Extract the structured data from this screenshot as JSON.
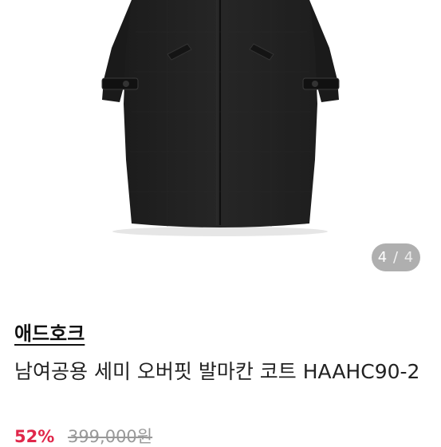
{
  "gallery": {
    "current_page": "4",
    "separator": "/",
    "total_pages": "4"
  },
  "product": {
    "brand": "애드호크",
    "title": "남여공용 세미 오버핏 발마칸 코트 HAAHC90-2",
    "discount_rate": "52%",
    "original_price": "399,000원"
  },
  "colors": {
    "accent": "#e0274a",
    "coat": "#222222",
    "indicator_bg": "#6e6e6e"
  }
}
